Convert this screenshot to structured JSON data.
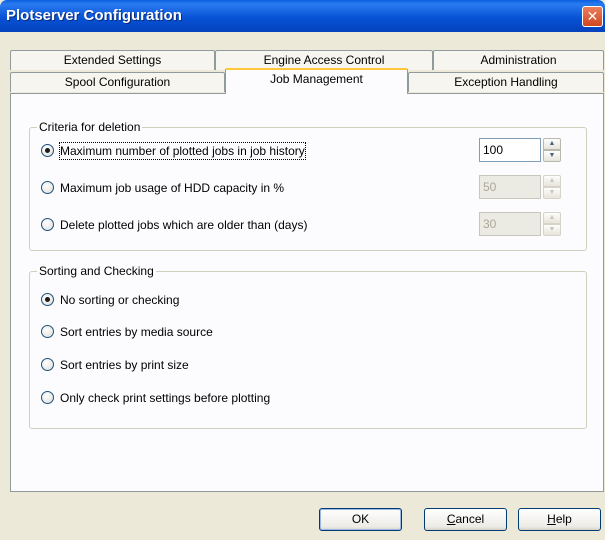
{
  "window": {
    "title": "Plotserver Configuration",
    "close_glyph": "✕"
  },
  "tabs": {
    "row1": [
      "Extended Settings",
      "Engine Access Control",
      "Administration"
    ],
    "row2": [
      "Spool Configuration",
      "Job Management",
      "Exception Handling"
    ],
    "active": "Job Management"
  },
  "criteria": {
    "legend": "Criteria for deletion",
    "options": [
      {
        "label": "Maximum number of plotted jobs in job history",
        "selected": true,
        "value": "100",
        "enabled": true
      },
      {
        "label": "Maximum job usage of HDD capacity in %",
        "selected": false,
        "value": "50",
        "enabled": false
      },
      {
        "label": "Delete plotted jobs which are older than (days)",
        "selected": false,
        "value": "30",
        "enabled": false
      }
    ]
  },
  "sorting": {
    "legend": "Sorting and Checking",
    "options": [
      {
        "label": "No sorting or checking",
        "selected": true
      },
      {
        "label": "Sort entries by media source",
        "selected": false
      },
      {
        "label": "Sort entries by print size",
        "selected": false
      },
      {
        "label": "Only check print settings before plotting",
        "selected": false
      }
    ]
  },
  "buttons": {
    "ok": "OK",
    "cancel_first": "C",
    "cancel_rest": "ancel",
    "help_first": "H",
    "help_rest": "elp"
  },
  "icons": {
    "spin_up": "spin-up-arrow-icon",
    "spin_down": "spin-down-arrow-icon",
    "close": "close-icon"
  }
}
